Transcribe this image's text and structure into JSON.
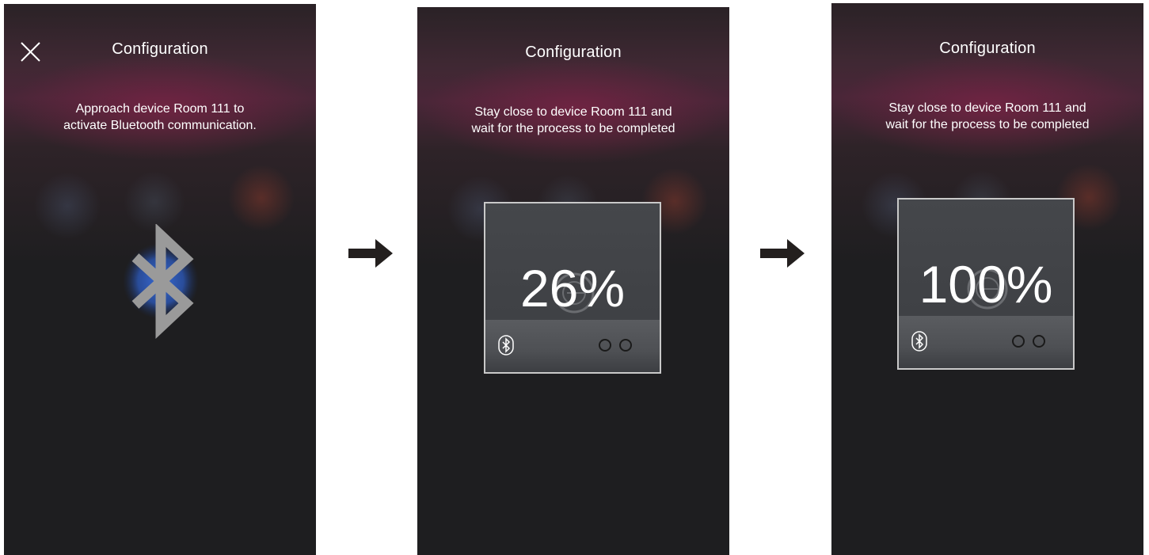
{
  "screens": [
    {
      "title": "Configuration",
      "message_line1": "Approach device Room 111 to",
      "message_line2": "activate Bluetooth communication."
    },
    {
      "title": "Configuration",
      "message_line1": "Stay close to device Room 111 and",
      "message_line2": "wait for the process to be completed",
      "progress_text": "26%",
      "progress": 0.26
    },
    {
      "title": "Configuration",
      "message_line1": "Stay close to device Room 111 and",
      "message_line2": "wait for the process to be completed",
      "progress_text": "100%",
      "progress": 1.0
    }
  ],
  "icons": {
    "close": "close-icon",
    "bluetooth": "bluetooth-icon",
    "arrow": "arrow-right-icon",
    "dots": "status-dots-icon"
  },
  "colors": {
    "screen_bg": "#1e1e20",
    "header_glow": "#7d2346",
    "bluetooth_glow": "#2f5ec8",
    "card_border": "#c9c9c9",
    "text": "#ffffff",
    "arrow": "#231f1e"
  }
}
